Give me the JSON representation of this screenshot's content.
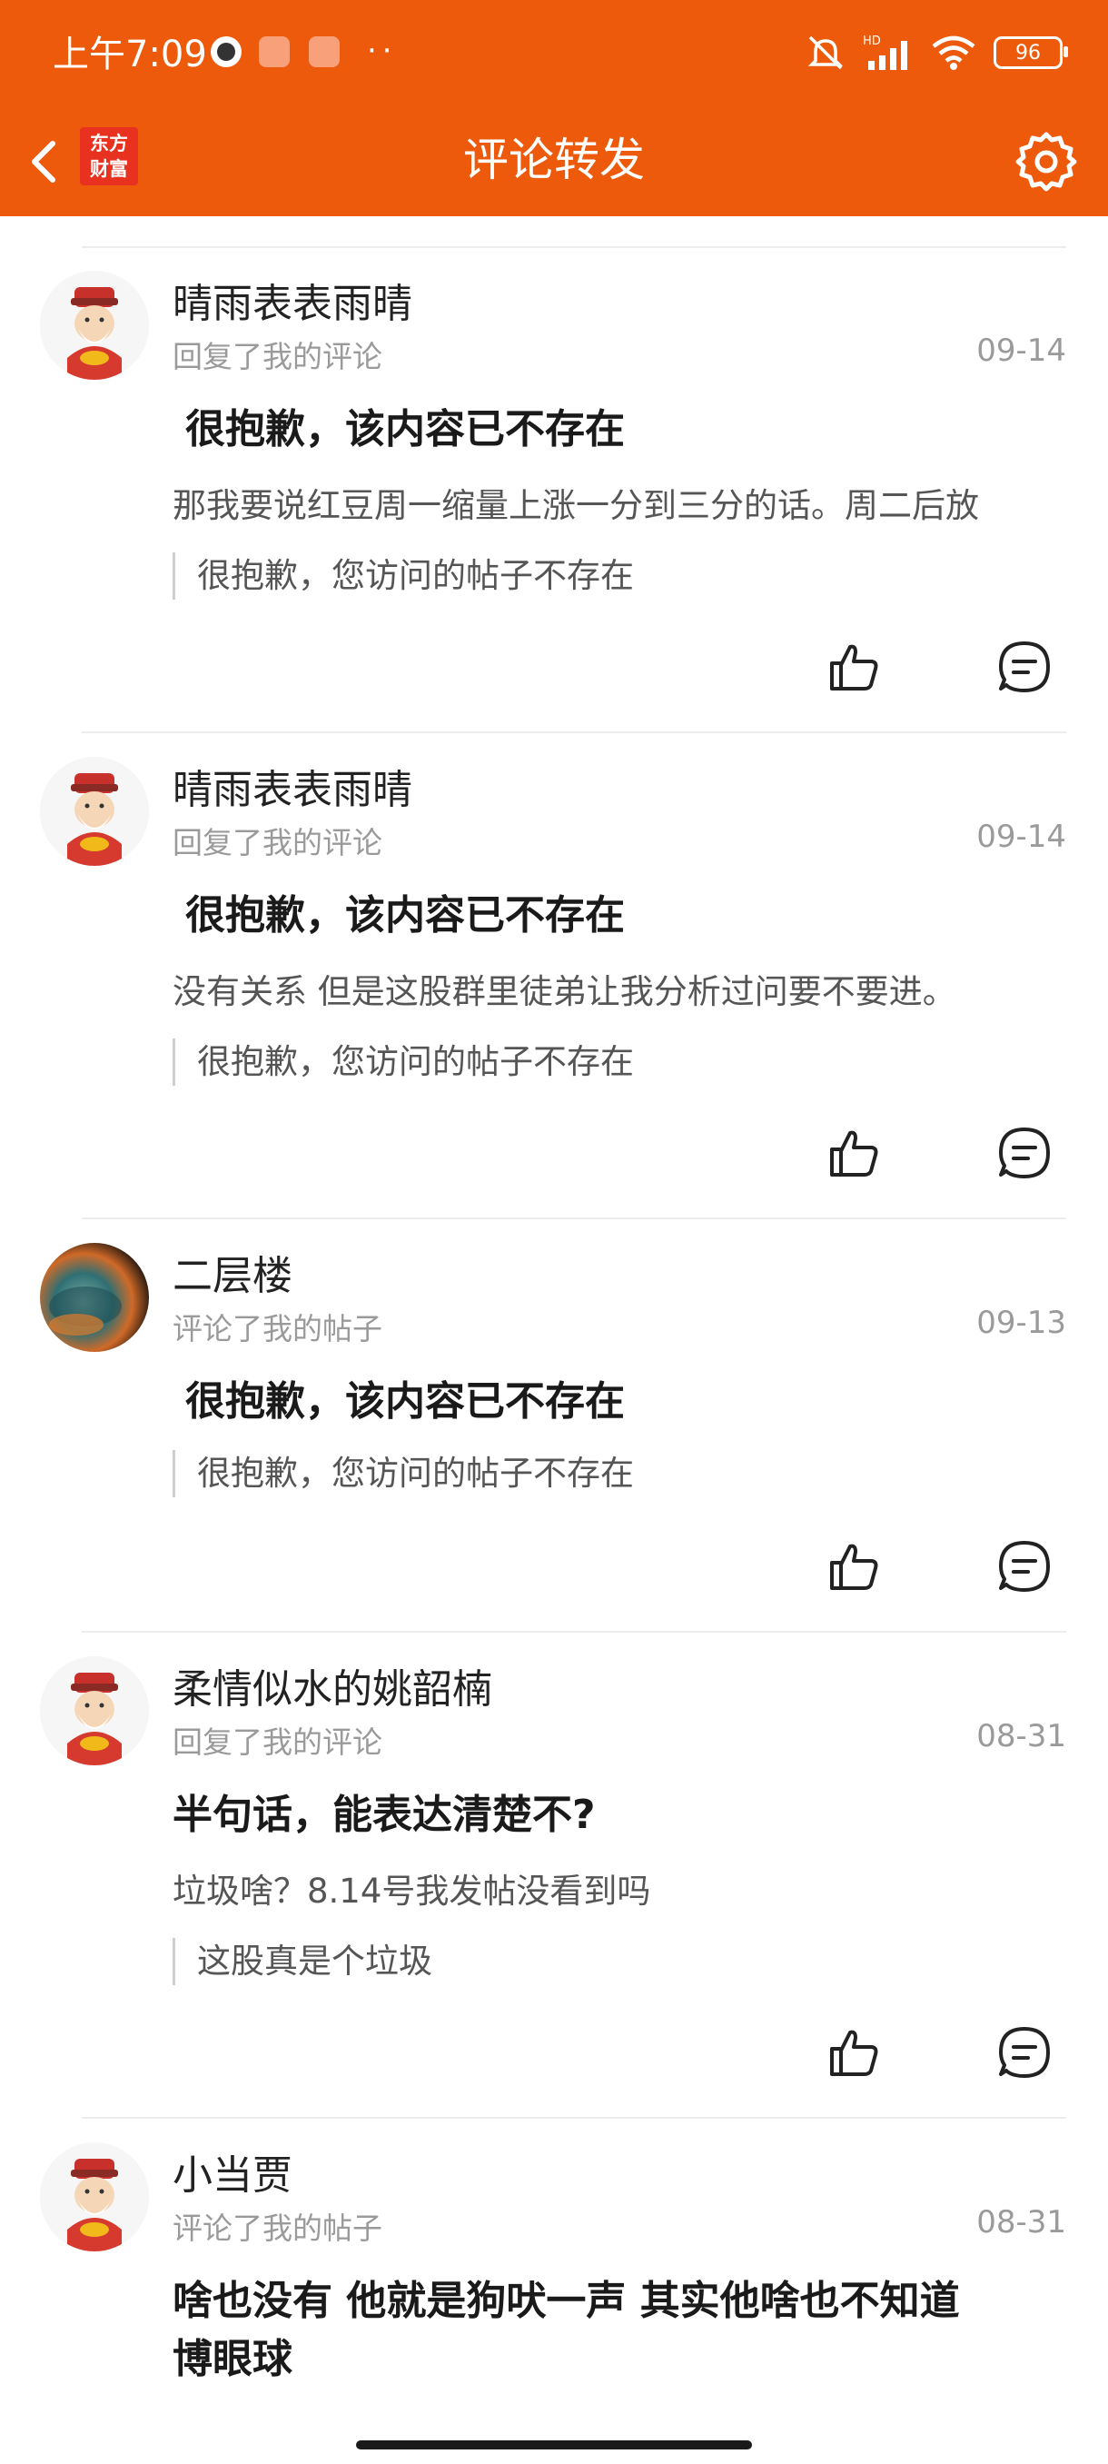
{
  "status_bar": {
    "time": "上午7:09",
    "battery": "96"
  },
  "header": {
    "title": "评论转发",
    "logo_line1": "东方",
    "logo_line2": "财富",
    "brand_color": "#ED5A0C"
  },
  "items": [
    {
      "name": "晴雨表表雨晴",
      "action": "回复了我的评论",
      "date": "09-14",
      "title": "很抱歉，该内容已不存在",
      "body": "那我要说红豆周一缩量上涨一分到三分的话。周二后放",
      "quote": "很抱歉，您访问的帖子不存在",
      "avatar": "caishen-avatar"
    },
    {
      "name": "晴雨表表雨晴",
      "action": "回复了我的评论",
      "date": "09-14",
      "title": "很抱歉，该内容已不存在",
      "body": "没有关系  但是这股群里徒弟让我分析过问要不要进。",
      "quote": "很抱歉，您访问的帖子不存在",
      "avatar": "caishen-avatar"
    },
    {
      "name": "二层楼",
      "action": "评论了我的帖子",
      "date": "09-13",
      "title": "很抱歉，该内容已不存在",
      "quote": "很抱歉，您访问的帖子不存在",
      "avatar": "photo-avatar"
    },
    {
      "name": "柔情似水的姚韶楠",
      "action": "回复了我的评论",
      "date": "08-31",
      "title": "半句话，能表达清楚不?",
      "body": "垃圾啥？8.14号我发帖没看到吗",
      "quote": "这股真是个垃圾",
      "avatar": "caishen-avatar"
    },
    {
      "name": "小当贾",
      "action": "评论了我的帖子",
      "date": "08-31",
      "title_line1": "啥也没有 他就是狗吠一声 其实他啥也不知道",
      "title_line2": "博眼球",
      "avatar": "caishen-avatar"
    }
  ]
}
